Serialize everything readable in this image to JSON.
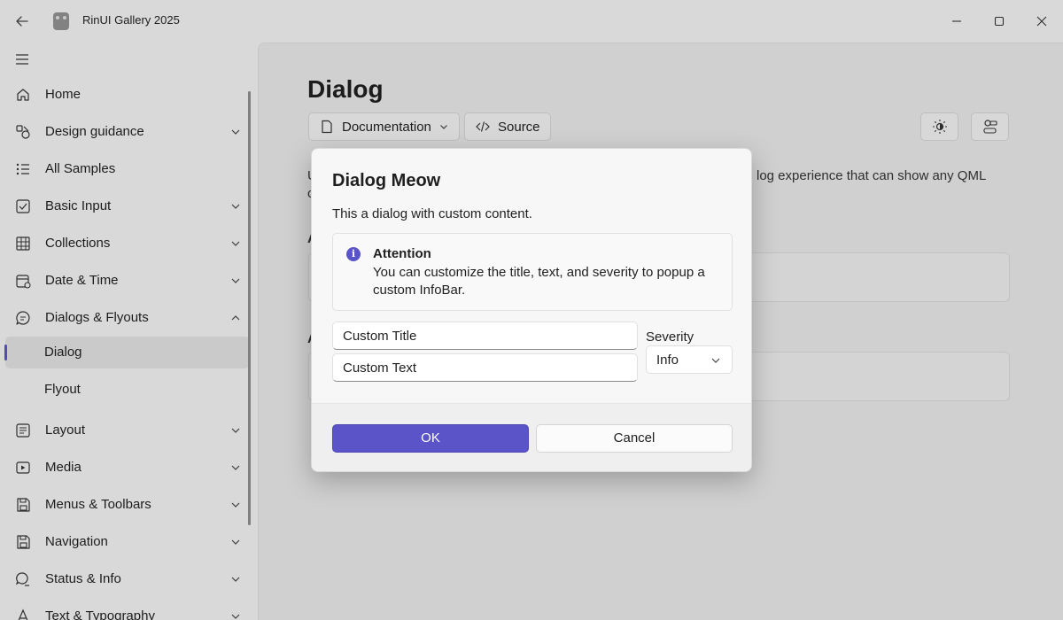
{
  "window": {
    "title": "RinUI Gallery 2025"
  },
  "sidebar": {
    "items": [
      {
        "label": "Home",
        "icon": "home-icon"
      },
      {
        "label": "Design guidance",
        "icon": "design-icon"
      },
      {
        "label": "All Samples",
        "icon": "list-icon"
      },
      {
        "label": "Basic Input",
        "icon": "checkbox-icon"
      },
      {
        "label": "Collections",
        "icon": "table-icon"
      },
      {
        "label": "Date & Time",
        "icon": "calendar-icon"
      },
      {
        "label": "Dialogs & Flyouts",
        "icon": "chat-icon"
      },
      {
        "label": "Dialog",
        "selected": true
      },
      {
        "label": "Flyout"
      },
      {
        "label": "Layout",
        "icon": "layout-icon"
      },
      {
        "label": "Media",
        "icon": "media-icon"
      },
      {
        "label": "Menus & Toolbars",
        "icon": "save-icon"
      },
      {
        "label": "Navigation",
        "icon": "save-icon"
      },
      {
        "label": "Status & Info",
        "icon": "status-icon"
      },
      {
        "label": "Text & Typography",
        "icon": "text-icon"
      }
    ]
  },
  "page": {
    "title": "Dialog",
    "documentation_label": "Documentation",
    "source_label": "Source",
    "desc_left": "U",
    "desc_right": "log experience that can show any QML",
    "desc_line2": "c",
    "section_a1": "A",
    "section_a2": "A"
  },
  "dialog": {
    "title": "Dialog Meow",
    "text": "This a dialog with custom content.",
    "infobar": {
      "title": "Attention",
      "message": "You can customize the title, text, and severity to popup a custom InfoBar.",
      "icon_glyph": "i"
    },
    "title_field": {
      "value": "Custom Title"
    },
    "text_field": {
      "value": "Custom Text"
    },
    "severity": {
      "label": "Severity",
      "value": "Info"
    },
    "ok_label": "OK",
    "cancel_label": "Cancel"
  },
  "colors": {
    "accent": "#5b53c8"
  }
}
